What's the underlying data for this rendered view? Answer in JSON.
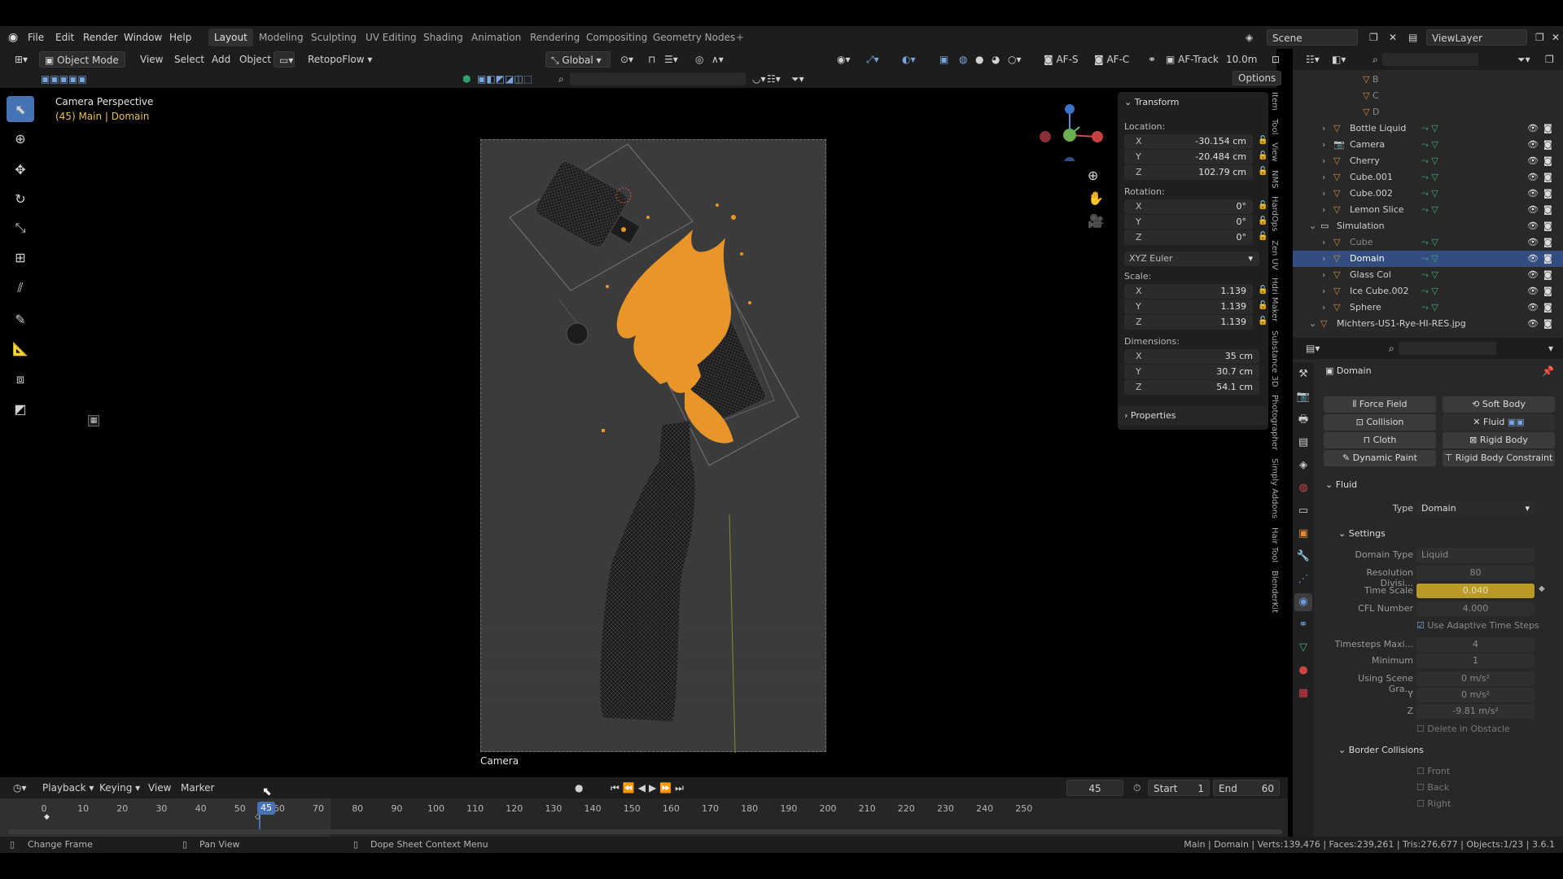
{
  "menu": {
    "items": [
      "File",
      "Edit",
      "Render",
      "Window",
      "Help"
    ]
  },
  "workspaces": [
    "Layout",
    "Modeling",
    "Sculpting",
    "UV Editing",
    "Shading",
    "Animation",
    "Rendering",
    "Compositing",
    "Geometry Nodes"
  ],
  "scene": {
    "name": "Scene",
    "view_layer": "ViewLayer"
  },
  "header": {
    "mode": "Object Mode",
    "view": "View",
    "select": "Select",
    "add": "Add",
    "object": "Object",
    "addon": "RetopoFlow",
    "transform": "Global",
    "af_s": "AF-S",
    "af_c": "AF-C",
    "af_track": "AF-Track",
    "distance": "10.0m",
    "options": "Options"
  },
  "viewport": {
    "title": "Camera Perspective",
    "subtitle": "(45) Main | Domain",
    "camera_label": "Camera"
  },
  "npanel": {
    "title": "Transform",
    "location_label": "Location:",
    "location": [
      {
        "axis": "X",
        "value": "-30.154 cm"
      },
      {
        "axis": "Y",
        "value": "-20.484 cm"
      },
      {
        "axis": "Z",
        "value": "102.79 cm"
      }
    ],
    "rotation_label": "Rotation:",
    "rotation": [
      {
        "axis": "X",
        "value": "0°"
      },
      {
        "axis": "Y",
        "value": "0°"
      },
      {
        "axis": "Z",
        "value": "0°"
      }
    ],
    "rotation_mode": "XYZ Euler",
    "scale_label": "Scale:",
    "scale": [
      {
        "axis": "X",
        "value": "1.139"
      },
      {
        "axis": "Y",
        "value": "1.139"
      },
      {
        "axis": "Z",
        "value": "1.139"
      }
    ],
    "dimensions_label": "Dimensions:",
    "dimensions": [
      {
        "axis": "X",
        "value": "35 cm"
      },
      {
        "axis": "Y",
        "value": "30.7 cm"
      },
      {
        "axis": "Z",
        "value": "54.1 cm"
      }
    ],
    "properties": "Properties"
  },
  "side_tabs": [
    "Item",
    "Tool",
    "View",
    "NMS",
    "HardOps",
    "Zen UV",
    "Hdri Maker",
    "Substance 3D",
    "Photographer",
    "Simply Addons",
    "Hair Tool",
    "BlenderKit"
  ],
  "outliner": {
    "top_items": [
      "B",
      "C",
      "D"
    ],
    "items": [
      {
        "name": "Bottle Liquid",
        "indent": 0
      },
      {
        "name": "Camera",
        "indent": 0
      },
      {
        "name": "Cherry",
        "indent": 0
      },
      {
        "name": "Cube.001",
        "indent": 0
      },
      {
        "name": "Cube.002",
        "indent": 0
      },
      {
        "name": "Lemon Slice",
        "indent": 0
      },
      {
        "name": "Simulation",
        "indent": -1
      },
      {
        "name": "Cube",
        "indent": 0
      },
      {
        "name": "Domain",
        "indent": 0
      },
      {
        "name": "Glass Col",
        "indent": 0
      },
      {
        "name": "Ice Cube.002",
        "indent": 0
      },
      {
        "name": "Sphere",
        "indent": 0
      },
      {
        "name": "Michters-US1-Rye-HI-RES.jpg",
        "indent": -1
      }
    ],
    "selected": "Domain"
  },
  "properties": {
    "object_name": "Domain",
    "physics_buttons": [
      "Force Field",
      "Soft Body",
      "Collision",
      "Fluid",
      "Cloth",
      "Rigid Body",
      "Dynamic Paint",
      "Rigid Body Constraint"
    ],
    "fluid_header": "Fluid",
    "type_label": "Type",
    "type_value": "Domain",
    "settings_header": "Settings",
    "fields": [
      {
        "label": "Domain Type",
        "value": "Liquid"
      },
      {
        "label": "Resolution Divisi...",
        "value": "80"
      },
      {
        "label": "Time Scale",
        "value": "0.040"
      },
      {
        "label": "CFL Number",
        "value": "4.000"
      },
      {
        "label": "",
        "value": "Use Adaptive Time Steps"
      },
      {
        "label": "Timesteps Maxi...",
        "value": "4"
      },
      {
        "label": "Minimum",
        "value": "1"
      },
      {
        "label": "Using Scene Gra...",
        "value": "0 m/s²"
      },
      {
        "label": "Y",
        "value": "0 m/s²"
      },
      {
        "label": "Z",
        "value": "-9.81 m/s²"
      },
      {
        "label": "",
        "value": "Delete in Obstacle"
      }
    ],
    "border_header": "Border Collisions",
    "border_items": [
      "Front",
      "Back",
      "Right"
    ]
  },
  "timeline": {
    "menus": [
      "Playback",
      "Keying",
      "View",
      "Marker"
    ],
    "current_frame": "45",
    "start_label": "Start",
    "start": "1",
    "end_label": "End",
    "end": "60",
    "ticks": [
      "0",
      "10",
      "20",
      "30",
      "40",
      "45",
      "50",
      "60",
      "70",
      "80",
      "90",
      "100",
      "110",
      "120",
      "130",
      "140",
      "150",
      "160",
      "170",
      "180",
      "190",
      "200",
      "210",
      "220",
      "230",
      "240",
      "250"
    ]
  },
  "status": {
    "left": "Change Frame",
    "mid": "Pan View",
    "right": "Dope Sheet Context Menu",
    "stats": "Main | Domain | Verts:139,476 | Faces:239,261 | Tris:276,677 | Objects:1/23 | 3.6.1"
  },
  "colors": {
    "accent": "#4772b3",
    "fluid": "#e8952a",
    "highlight": "#c9a227"
  }
}
